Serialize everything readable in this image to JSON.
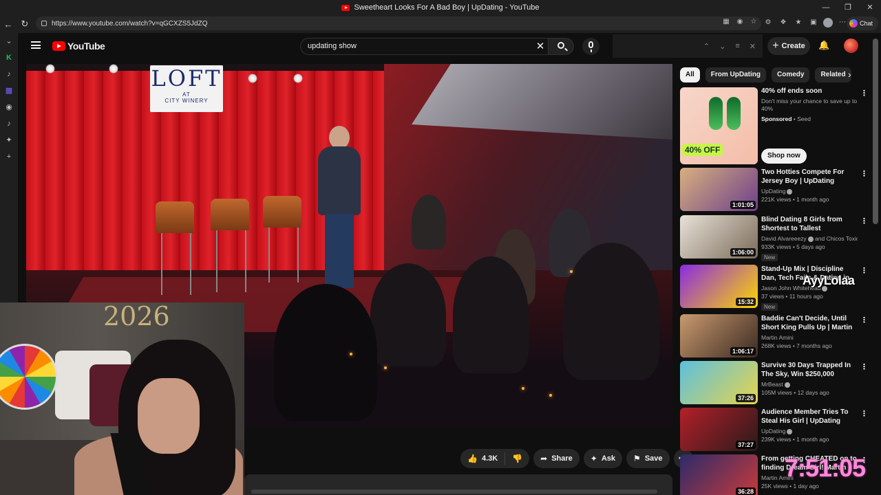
{
  "browser": {
    "window_title": "Sweetheart Looks For A Bad Boy | UpDating - YouTube",
    "url": "https://www.youtube.com/watch?v=qGCXZS5JdZQ",
    "chat_label": "Chat",
    "window_controls": [
      "—",
      "❐",
      "✕"
    ]
  },
  "header": {
    "logo_text": "YouTube",
    "search_value": "updating show",
    "create_label": "Create"
  },
  "video": {
    "sign_main": "LOFT",
    "sign_sub": "AT",
    "sign_sub2": "CITY WINERY"
  },
  "webcam": {
    "balloon_text": "2026"
  },
  "actions": {
    "like_count": "4.3K",
    "share_label": "Share",
    "ask_label": "Ask",
    "save_label": "Save"
  },
  "chips": [
    "All",
    "From UpDating",
    "Comedy",
    "Related"
  ],
  "ad": {
    "title": "40% off ends soon",
    "description": "Don't miss your chance to save up to 40%",
    "sponsored_label": "Sponsored",
    "advertiser": "Seed",
    "badge": "40% OFF",
    "cta": "Shop now"
  },
  "recommendations": [
    {
      "title": "Two Hotties Compete For Jersey Boy | UpDating",
      "channel": "UpDating",
      "verified": true,
      "stats": "221K views • 1 month ago",
      "duration": "1:01:05",
      "is_new": false,
      "colors": [
        "#d9b07f",
        "#6c3f8a"
      ]
    },
    {
      "title": "Blind Dating 8 Girls from Shortest to Tallest",
      "channel": "David Alvareeezy",
      "channel_extra": "and Chicos Toxicos",
      "verified": true,
      "stats": "933K views • 5 days ago",
      "duration": "1:06:00",
      "is_new": true,
      "colors": [
        "#e8e2d8",
        "#7a6b5a"
      ]
    },
    {
      "title": "Stand-Up Mix | Discipline Dan, Tech Fails & Dating in America",
      "channel": "Jason John Whitehead",
      "verified": true,
      "stats": "37 views • 11 hours ago",
      "duration": "15:32",
      "is_new": true,
      "colors": [
        "#8a2be2",
        "#ffd700"
      ]
    },
    {
      "title": "Baddie Can't Decide, Until Short King Pulls Up | Martin Amini | ...",
      "channel": "Martin Amini",
      "verified": false,
      "stats": "268K views • 7 months ago",
      "duration": "1:06:17",
      "is_new": false,
      "colors": [
        "#c99a6e",
        "#3b2a22"
      ]
    },
    {
      "title": "Survive 30 Days Trapped In The Sky, Win $250,000",
      "channel": "MrBeast",
      "verified": true,
      "stats": "105M views • 12 days ago",
      "duration": "37:26",
      "is_new": false,
      "colors": [
        "#5bc0de",
        "#e8d44d"
      ]
    },
    {
      "title": "Audience Member Tries To Steal His Girl | UpDating",
      "channel": "UpDating",
      "verified": true,
      "stats": "239K views • 1 month ago",
      "duration": "37:27",
      "is_new": false,
      "colors": [
        "#b3202a",
        "#2a1a1a"
      ]
    },
    {
      "title": "From getting CHEATED on to finding Dream Girl! Martin Amini",
      "channel": "Martin Amini",
      "verified": false,
      "stats": "25K views • 1 day ago",
      "duration": "36:28",
      "is_new": false,
      "colors": [
        "#2b2b6b",
        "#c93a3a"
      ]
    }
  ],
  "overlays": {
    "logo_text": "AyyLolaa",
    "clock": "7:51:05"
  },
  "theme": {
    "background": "#0f0f0f",
    "accent": "#ff0000",
    "clock_color": "#ff8ad8"
  }
}
